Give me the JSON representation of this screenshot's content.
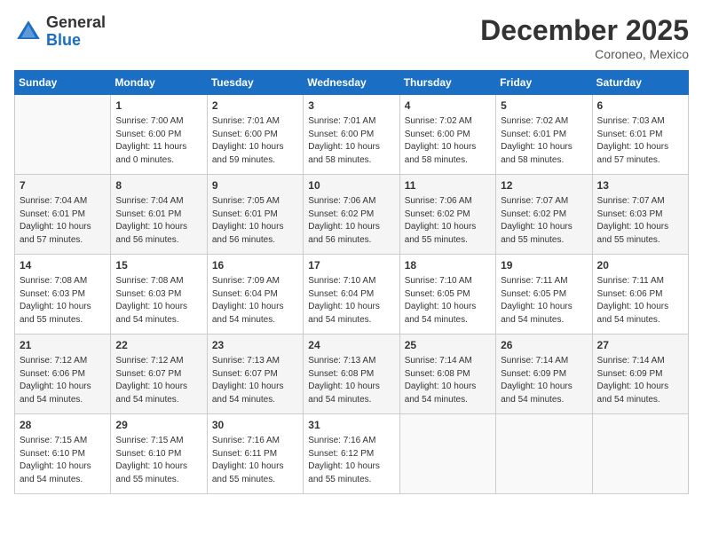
{
  "header": {
    "logo_line1": "General",
    "logo_line2": "Blue",
    "month_title": "December 2025",
    "location": "Coroneo, Mexico"
  },
  "days_of_week": [
    "Sunday",
    "Monday",
    "Tuesday",
    "Wednesday",
    "Thursday",
    "Friday",
    "Saturday"
  ],
  "weeks": [
    [
      {
        "day": "",
        "info": ""
      },
      {
        "day": "1",
        "info": "Sunrise: 7:00 AM\nSunset: 6:00 PM\nDaylight: 11 hours\nand 0 minutes."
      },
      {
        "day": "2",
        "info": "Sunrise: 7:01 AM\nSunset: 6:00 PM\nDaylight: 10 hours\nand 59 minutes."
      },
      {
        "day": "3",
        "info": "Sunrise: 7:01 AM\nSunset: 6:00 PM\nDaylight: 10 hours\nand 58 minutes."
      },
      {
        "day": "4",
        "info": "Sunrise: 7:02 AM\nSunset: 6:00 PM\nDaylight: 10 hours\nand 58 minutes."
      },
      {
        "day": "5",
        "info": "Sunrise: 7:02 AM\nSunset: 6:01 PM\nDaylight: 10 hours\nand 58 minutes."
      },
      {
        "day": "6",
        "info": "Sunrise: 7:03 AM\nSunset: 6:01 PM\nDaylight: 10 hours\nand 57 minutes."
      }
    ],
    [
      {
        "day": "7",
        "info": "Sunrise: 7:04 AM\nSunset: 6:01 PM\nDaylight: 10 hours\nand 57 minutes."
      },
      {
        "day": "8",
        "info": "Sunrise: 7:04 AM\nSunset: 6:01 PM\nDaylight: 10 hours\nand 56 minutes."
      },
      {
        "day": "9",
        "info": "Sunrise: 7:05 AM\nSunset: 6:01 PM\nDaylight: 10 hours\nand 56 minutes."
      },
      {
        "day": "10",
        "info": "Sunrise: 7:06 AM\nSunset: 6:02 PM\nDaylight: 10 hours\nand 56 minutes."
      },
      {
        "day": "11",
        "info": "Sunrise: 7:06 AM\nSunset: 6:02 PM\nDaylight: 10 hours\nand 55 minutes."
      },
      {
        "day": "12",
        "info": "Sunrise: 7:07 AM\nSunset: 6:02 PM\nDaylight: 10 hours\nand 55 minutes."
      },
      {
        "day": "13",
        "info": "Sunrise: 7:07 AM\nSunset: 6:03 PM\nDaylight: 10 hours\nand 55 minutes."
      }
    ],
    [
      {
        "day": "14",
        "info": "Sunrise: 7:08 AM\nSunset: 6:03 PM\nDaylight: 10 hours\nand 55 minutes."
      },
      {
        "day": "15",
        "info": "Sunrise: 7:08 AM\nSunset: 6:03 PM\nDaylight: 10 hours\nand 54 minutes."
      },
      {
        "day": "16",
        "info": "Sunrise: 7:09 AM\nSunset: 6:04 PM\nDaylight: 10 hours\nand 54 minutes."
      },
      {
        "day": "17",
        "info": "Sunrise: 7:10 AM\nSunset: 6:04 PM\nDaylight: 10 hours\nand 54 minutes."
      },
      {
        "day": "18",
        "info": "Sunrise: 7:10 AM\nSunset: 6:05 PM\nDaylight: 10 hours\nand 54 minutes."
      },
      {
        "day": "19",
        "info": "Sunrise: 7:11 AM\nSunset: 6:05 PM\nDaylight: 10 hours\nand 54 minutes."
      },
      {
        "day": "20",
        "info": "Sunrise: 7:11 AM\nSunset: 6:06 PM\nDaylight: 10 hours\nand 54 minutes."
      }
    ],
    [
      {
        "day": "21",
        "info": "Sunrise: 7:12 AM\nSunset: 6:06 PM\nDaylight: 10 hours\nand 54 minutes."
      },
      {
        "day": "22",
        "info": "Sunrise: 7:12 AM\nSunset: 6:07 PM\nDaylight: 10 hours\nand 54 minutes."
      },
      {
        "day": "23",
        "info": "Sunrise: 7:13 AM\nSunset: 6:07 PM\nDaylight: 10 hours\nand 54 minutes."
      },
      {
        "day": "24",
        "info": "Sunrise: 7:13 AM\nSunset: 6:08 PM\nDaylight: 10 hours\nand 54 minutes."
      },
      {
        "day": "25",
        "info": "Sunrise: 7:14 AM\nSunset: 6:08 PM\nDaylight: 10 hours\nand 54 minutes."
      },
      {
        "day": "26",
        "info": "Sunrise: 7:14 AM\nSunset: 6:09 PM\nDaylight: 10 hours\nand 54 minutes."
      },
      {
        "day": "27",
        "info": "Sunrise: 7:14 AM\nSunset: 6:09 PM\nDaylight: 10 hours\nand 54 minutes."
      }
    ],
    [
      {
        "day": "28",
        "info": "Sunrise: 7:15 AM\nSunset: 6:10 PM\nDaylight: 10 hours\nand 54 minutes."
      },
      {
        "day": "29",
        "info": "Sunrise: 7:15 AM\nSunset: 6:10 PM\nDaylight: 10 hours\nand 55 minutes."
      },
      {
        "day": "30",
        "info": "Sunrise: 7:16 AM\nSunset: 6:11 PM\nDaylight: 10 hours\nand 55 minutes."
      },
      {
        "day": "31",
        "info": "Sunrise: 7:16 AM\nSunset: 6:12 PM\nDaylight: 10 hours\nand 55 minutes."
      },
      {
        "day": "",
        "info": ""
      },
      {
        "day": "",
        "info": ""
      },
      {
        "day": "",
        "info": ""
      }
    ]
  ]
}
